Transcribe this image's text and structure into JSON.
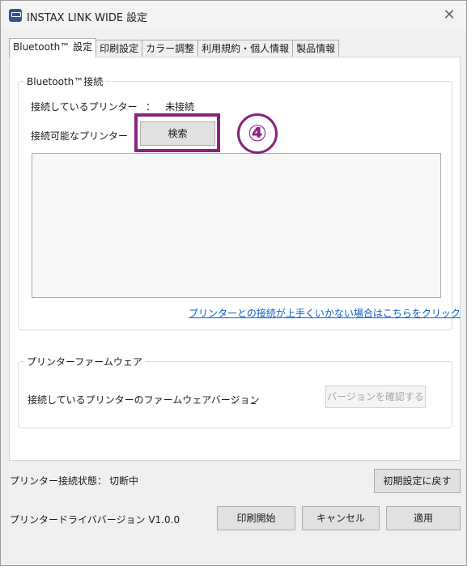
{
  "window": {
    "title": "INSTAX LINK WIDE 設定",
    "app_icon": "printer-app-icon",
    "close_icon": "✕"
  },
  "tabs": [
    {
      "label": "Bluetooth™ 設定",
      "active": true
    },
    {
      "label": "印刷設定",
      "active": false
    },
    {
      "label": "カラー調整",
      "active": false
    },
    {
      "label": "利用規約・個人情報",
      "active": false
    },
    {
      "label": "製品情報",
      "active": false
    }
  ],
  "bluetooth": {
    "group_title": "Bluetooth™接続",
    "connected_printer_label": "接続しているプリンター",
    "separator": "：",
    "connected_printer_value": "未接続",
    "available_printers_label": "接続可能なプリンター",
    "search_button": "検索",
    "help_link": "プリンターとの接続が上手くいかない場合はこちらをクリック"
  },
  "firmware": {
    "group_title": "プリンターファームウェア",
    "version_label": "接続しているプリンターのファームウェアバージョン",
    "separator": "：",
    "version_value": "_",
    "check_button": "バージョンを確認する"
  },
  "annotation": {
    "step_number": "④",
    "color": "#8b2280"
  },
  "footer": {
    "status_label": "プリンター接続状態：",
    "status_value": "切断中",
    "reset_button": "初期設定に戻す",
    "driver_version": "プリンタードライババージョン V1.0.0",
    "print_button": "印刷開始",
    "cancel_button": "キャンセル",
    "apply_button": "適用"
  }
}
